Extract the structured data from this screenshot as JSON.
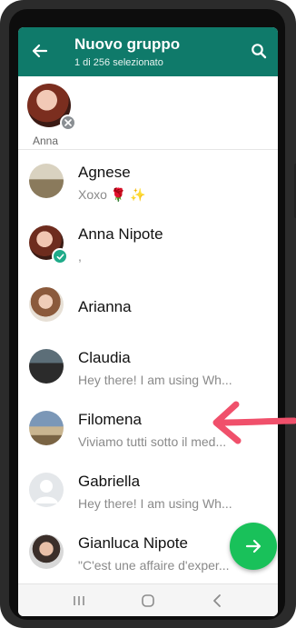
{
  "header": {
    "title": "Nuovo gruppo",
    "subtitle": "1 di 256 selezionato",
    "color": "#0f7a6a"
  },
  "selected": [
    {
      "name": "Anna"
    }
  ],
  "contacts": [
    {
      "name": "Agnese",
      "status": "Xoxo 🌹 ✨",
      "selected": false
    },
    {
      "name": "Anna Nipote",
      "status": ",",
      "selected": true
    },
    {
      "name": "Arianna",
      "status": "",
      "selected": false
    },
    {
      "name": "Claudia",
      "status": "Hey there! I am using Wh...",
      "selected": false
    },
    {
      "name": "Filomena",
      "status": "Viviamo tutti sotto il med...",
      "selected": false
    },
    {
      "name": "Gabriella",
      "status": "Hey there! I am using Wh...",
      "selected": false
    },
    {
      "name": "Gianluca Nipote",
      "status": "\"C'est une affaire d'exper...",
      "selected": false
    }
  ],
  "icons": {
    "back": "arrow-left-icon",
    "search": "search-icon",
    "fab": "arrow-right-icon",
    "nav_recent": "recent-apps-icon",
    "nav_home": "home-icon",
    "nav_back": "nav-back-icon"
  },
  "colors": {
    "accent": "#0f7a6a",
    "check": "#1fab89",
    "fab": "#19c15a",
    "annotation": "#f0506b"
  }
}
